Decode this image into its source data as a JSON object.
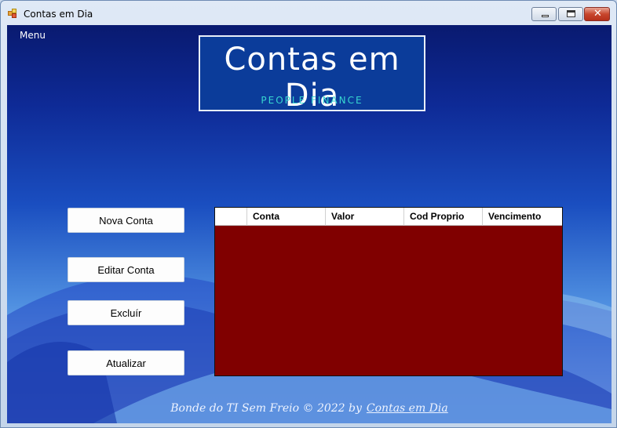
{
  "window": {
    "title": "Contas em Dia",
    "controls": {
      "minimize": "minimize",
      "maximize": "maximize",
      "close": "✕"
    }
  },
  "menu": {
    "label": "Menu"
  },
  "logo": {
    "title": "Contas em Dia",
    "subtitle": "PEOPLE FINANCE"
  },
  "actions": {
    "new": "Nova Conta",
    "edit": "Editar Conta",
    "delete": "Excluír",
    "refresh": "Atualizar"
  },
  "grid": {
    "columns": [
      "Conta",
      "Valor",
      "Cod Proprio",
      "Vencimento"
    ],
    "rows": [],
    "background": "#800000"
  },
  "footer": {
    "text": "Bonde do TI Sem Freio © 2022  by",
    "link": "Contas em Dia"
  },
  "colors": {
    "accent_close": "#c8462d",
    "grid_bg": "#800000",
    "logo_sub": "#37d6d0"
  }
}
